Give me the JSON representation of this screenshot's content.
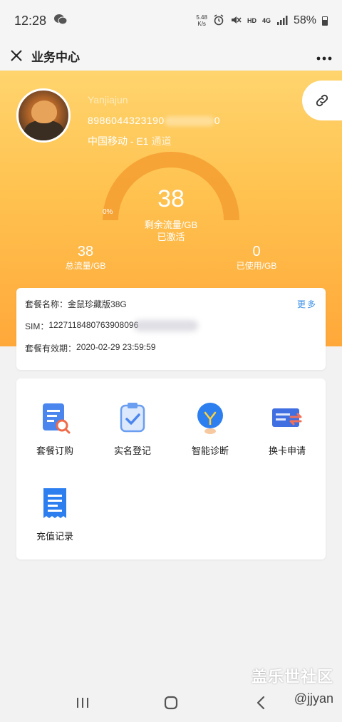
{
  "status_bar": {
    "time": "12:28",
    "net_speed_value": "5.48",
    "net_speed_unit": "K/s",
    "hd": "HD",
    "network": "4G",
    "battery": "58%"
  },
  "title_bar": {
    "title": "业务中心"
  },
  "user": {
    "name": "Yanjiajun",
    "iccid": "8986044323190",
    "iccid_tail": "0",
    "carrier": "中国移动 - E1",
    "channel": "通道"
  },
  "gauge": {
    "remaining": "38",
    "remaining_label": "剩余流量/GB",
    "status": "已激活",
    "percent_label": "0%",
    "used_fraction": 0
  },
  "stats": {
    "total_value": "38",
    "total_label": "总流量/GB",
    "used_value": "0",
    "used_label": "已使用/GB"
  },
  "package": {
    "name_label": "套餐名称：",
    "name_value": "金鼠珍藏版38G",
    "more": "更多",
    "sim_label": "SIM：",
    "sim_value": "1227118480763908096",
    "expiry_label": "套餐有效期：",
    "expiry_value": "2020-02-29 23:59:59"
  },
  "menu": {
    "items": [
      {
        "label": "套餐订购",
        "icon": "document-search-icon"
      },
      {
        "label": "实名登记",
        "icon": "clipboard-check-icon"
      },
      {
        "label": "智能诊断",
        "icon": "lightbulb-icon"
      },
      {
        "label": "换卡申请",
        "icon": "card-swap-icon"
      },
      {
        "label": "充值记录",
        "icon": "receipt-icon"
      }
    ]
  },
  "watermark": {
    "brand": "盖乐世社区",
    "handle": "@jjyan"
  },
  "colors": {
    "hero_top": "#ffd46e",
    "hero_bottom": "#ffa83a",
    "gauge_arc": "#f5a033",
    "link_blue": "#3a8ee6",
    "icon_blue": "#4a86ee"
  }
}
